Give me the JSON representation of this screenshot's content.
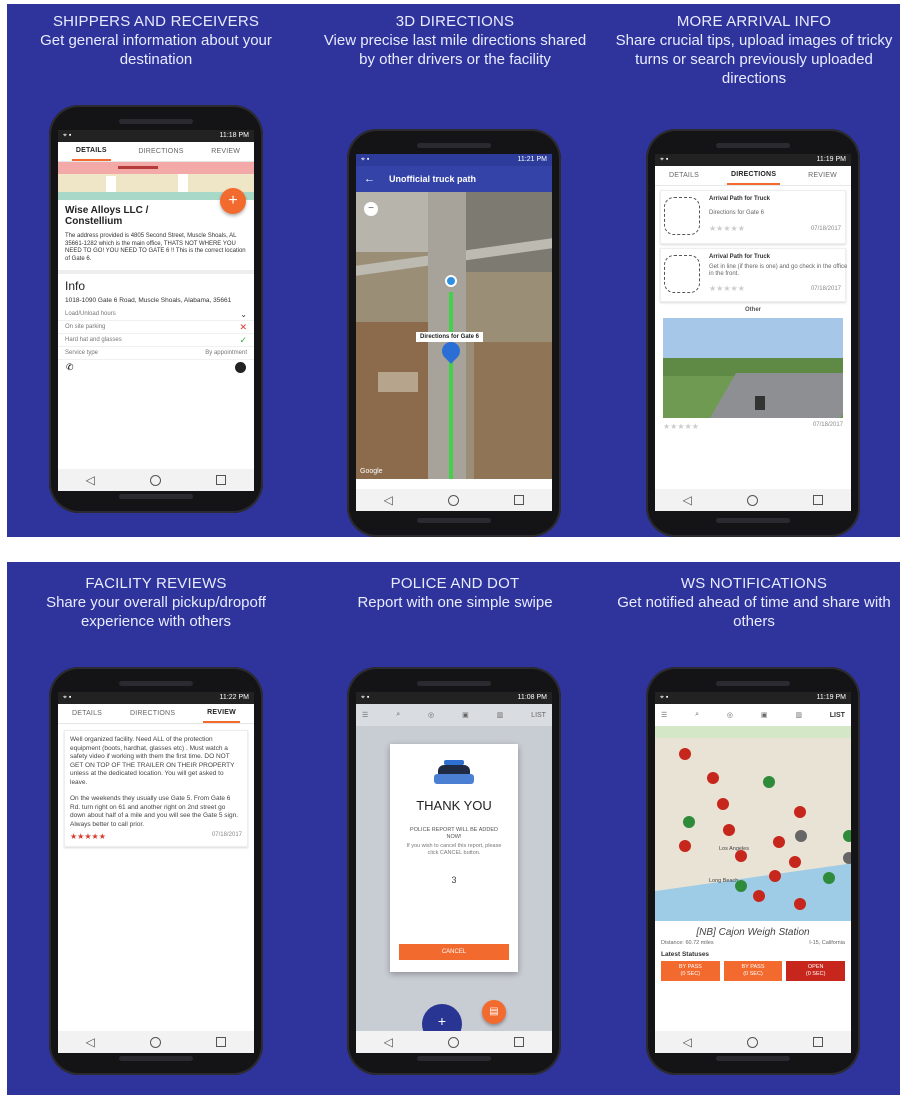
{
  "panels": [
    {
      "title": "SHIPPERS AND RECEIVERS",
      "desc": "Get general information about your destination",
      "status_time": "11:18 PM",
      "tabs": [
        "DETAILS",
        "DIRECTIONS",
        "REVIEW"
      ],
      "active_tab": "DETAILS",
      "facility_name": "Wise Alloys LLC / Constellium",
      "facility_note": "The address provided is 4805 Second Street, Muscle Shoals, AL 35661-1282 which is the main office, THATS NOT WHERE YOU NEED TO GO! YOU NEED TO GATE 6 !! This is the correct location of Gate 6.",
      "info_heading": "Info",
      "info_address": "1018-1090 Gate 6 Road, Muscle Shoals, Alabama, 35661",
      "rows": [
        {
          "label": "Load/Unload hours",
          "value": "⌄"
        },
        {
          "label": "On site parking",
          "value": "✕"
        },
        {
          "label": "Hard hat and glasses",
          "value": "✓"
        },
        {
          "label": "Service type",
          "value": "By appointment"
        }
      ],
      "fab_label": "+"
    },
    {
      "title": "3D DIRECTIONS",
      "desc": "View precise last mile directions shared by other drivers or the facility",
      "status_time": "11:21 PM",
      "toolbar_title": "Unofficial truck path",
      "map_label": "Directions for Gate 6",
      "map_attr": "Google",
      "zoom_out": "−"
    },
    {
      "title": "MORE ARRIVAL INFO",
      "desc": "Share crucial tips, upload images of tricky turns or search previously uploaded directions",
      "status_time": "11:19 PM",
      "tabs": [
        "DETAILS",
        "DIRECTIONS",
        "REVIEW"
      ],
      "active_tab": "DIRECTIONS",
      "cards": [
        {
          "title": "Arrival Path for Truck",
          "text": "Directions for Gate 6",
          "date": "07/18/2017"
        },
        {
          "title": "Arrival Path for Truck",
          "text": "Get in line (if there is one) and go check in the office in the front.",
          "date": "07/18/2017"
        }
      ],
      "other_label": "Other",
      "photo_date": "07/18/2017"
    },
    {
      "title": "FACILITY REVIEWS",
      "desc": "Share your overall pickup/dropoff experience with others",
      "status_time": "11:22 PM",
      "tabs": [
        "DETAILS",
        "DIRECTIONS",
        "REVIEW"
      ],
      "active_tab": "REVIEW",
      "review_p1": "Well organized facility. Need ALL of the protection equipment (boots, hardhat, glasses etc) . Must watch a safety video if working with them the first time. DO NOT GET ON TOP OF THE TRAILER ON THEIR PROPERTY unless at the dedicated location. You will get asked to leave.",
      "review_p2": "On the weekends they usually use Gate 5. From Gate 6 Rd. turn right on 61 and another right on 2nd street go down about half of a mile and you will see the Gate 5 sign. Always better to call prior.",
      "review_stars": "★★★★★",
      "review_date": "07/18/2017"
    },
    {
      "title": "POLICE AND DOT",
      "desc": "Report with one simple swipe",
      "status_time": "11:08 PM",
      "toolbar_list": "LIST",
      "dialog_title": "THANK YOU",
      "dialog_sub": "POLICE REPORT WILL BE ADDED NOW!",
      "dialog_msg": "If you wish to cancel this report, please click CANCEL button.",
      "countdown": "3",
      "cancel_label": "CANCEL"
    },
    {
      "title": "WS NOTIFICATIONS",
      "desc": "Get notified ahead of time and share with others",
      "status_time": "11:19 PM",
      "toolbar_list": "LIST",
      "map_places": [
        "Los Angeles",
        "Long Beach"
      ],
      "station_name": "[NB] Cajon Weigh Station",
      "distance": "Distance: 60.72 miles",
      "route": "I-15, California",
      "latest_label": "Latest Statuses",
      "statuses": [
        {
          "line1": "BY PASS",
          "line2": "(0 SEC)",
          "color": "#f26a2e"
        },
        {
          "line1": "BY PASS",
          "line2": "(0 SEC)",
          "color": "#f26a2e"
        },
        {
          "line1": "OPEN",
          "line2": "(0 SEC)",
          "color": "#c7261d"
        }
      ]
    }
  ],
  "colors": {
    "background": "#2e349c",
    "accent": "#f26a2e",
    "danger": "#d93b2b"
  },
  "nav": {
    "back": "◁",
    "home": "○"
  }
}
